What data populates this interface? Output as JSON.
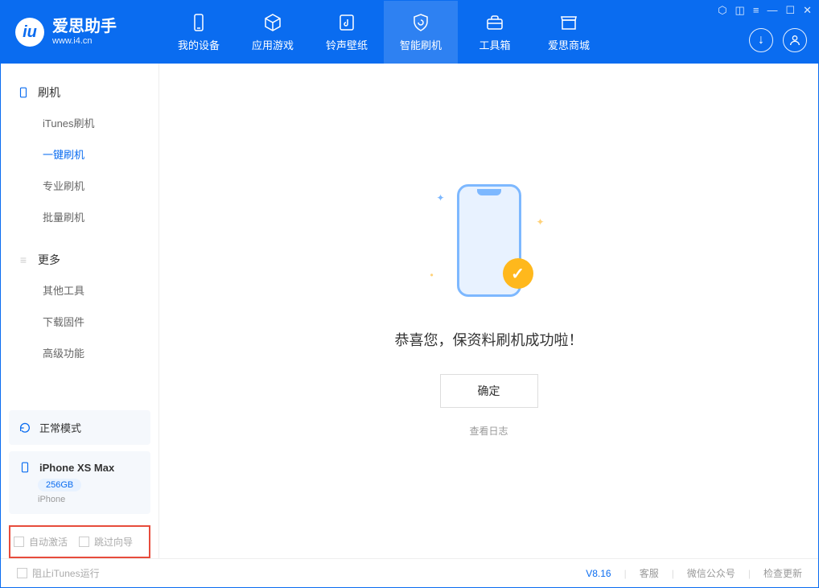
{
  "logo": {
    "title": "爱思助手",
    "url": "www.i4.cn"
  },
  "tabs": [
    {
      "label": "我的设备"
    },
    {
      "label": "应用游戏"
    },
    {
      "label": "铃声壁纸"
    },
    {
      "label": "智能刷机"
    },
    {
      "label": "工具箱"
    },
    {
      "label": "爱思商城"
    }
  ],
  "sidebar": {
    "section1": "刷机",
    "items1": [
      "iTunes刷机",
      "一键刷机",
      "专业刷机",
      "批量刷机"
    ],
    "section2": "更多",
    "items2": [
      "其他工具",
      "下载固件",
      "高级功能"
    ]
  },
  "device": {
    "mode": "正常模式",
    "name": "iPhone XS Max",
    "storage": "256GB",
    "type": "iPhone"
  },
  "checkboxes": {
    "auto_activate": "自动激活",
    "skip_guide": "跳过向导"
  },
  "main": {
    "success_msg": "恭喜您，保资料刷机成功啦！",
    "ok_button": "确定",
    "view_log": "查看日志"
  },
  "footer": {
    "block_itunes": "阻止iTunes运行",
    "version": "V8.16",
    "service": "客服",
    "wechat": "微信公众号",
    "check_update": "检查更新"
  }
}
